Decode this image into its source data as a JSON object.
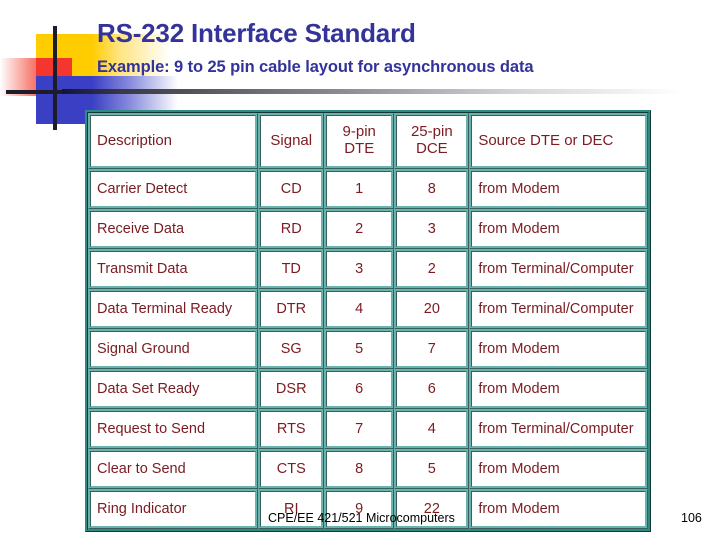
{
  "slide": {
    "title": "RS-232 Interface Standard",
    "subtitle": "Example: 9 to 25 pin cable layout for asynchronous data",
    "title_color": "#333399",
    "table_border_color": "#2E8B84",
    "table_text_color": "#7B1B22"
  },
  "table": {
    "headers": {
      "description": "Description",
      "signal": "Signal",
      "dte_line1": "9-pin",
      "dte_line2": "DTE",
      "dce_line1": "25-pin",
      "dce_line2": "DCE",
      "source": "Source DTE or DEC"
    },
    "rows": [
      {
        "description": "Carrier Detect",
        "signal": "CD",
        "dte": "1",
        "dce": "8",
        "source": "from Modem"
      },
      {
        "description": "Receive Data",
        "signal": "RD",
        "dte": "2",
        "dce": "3",
        "source": "from Modem"
      },
      {
        "description": "Transmit Data",
        "signal": "TD",
        "dte": "3",
        "dce": "2",
        "source": "from Terminal/Computer"
      },
      {
        "description": "Data Terminal Ready",
        "signal": "DTR",
        "dte": "4",
        "dce": "20",
        "source": "from Terminal/Computer"
      },
      {
        "description": "Signal Ground",
        "signal": "SG",
        "dte": "5",
        "dce": "7",
        "source": "from Modem"
      },
      {
        "description": "Data Set Ready",
        "signal": "DSR",
        "dte": "6",
        "dce": "6",
        "source": "from Modem"
      },
      {
        "description": "Request to Send",
        "signal": "RTS",
        "dte": "7",
        "dce": "4",
        "source": "from Terminal/Computer"
      },
      {
        "description": "Clear to Send",
        "signal": "CTS",
        "dte": "8",
        "dce": "5",
        "source": "from Modem"
      },
      {
        "description": "Ring Indicator",
        "signal": "RI",
        "dte": "9",
        "dce": "22",
        "source": "from Modem"
      }
    ]
  },
  "footer": {
    "course": "CPE/EE 421/521 Microcomputers",
    "page_number": "106"
  }
}
